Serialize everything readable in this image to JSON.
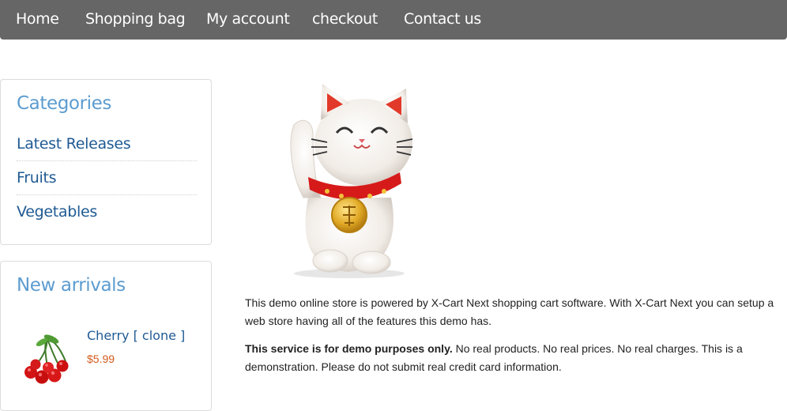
{
  "nav": {
    "items": [
      "Home",
      "Shopping bag",
      "My account",
      "checkout",
      "Contact us"
    ]
  },
  "categories": {
    "title": "Categories",
    "items": [
      "Latest Releases",
      "Fruits",
      "Vegetables"
    ]
  },
  "new_arrivals": {
    "title": "New arrivals",
    "product": {
      "name": "Cherry [ clone ]",
      "price": "$5.99"
    }
  },
  "main": {
    "mascot_icon": "lucky-cat-icon",
    "intro_line1": "This demo online store is powered by X-Cart Next shopping cart software. With X-Cart Next you can setup a",
    "intro_line2": "web store having all of the features this demo has.",
    "notice_bold": "This service is for demo purposes only.",
    "notice_rest": " No real products. No real prices. No real charges. This is a",
    "notice_line2": "demonstration. Please do not submit real credit card information."
  },
  "colors": {
    "nav_bg": "#666666",
    "box_title": "#5c9cd0",
    "link": "#1f5a93",
    "price": "#d35a1a"
  }
}
